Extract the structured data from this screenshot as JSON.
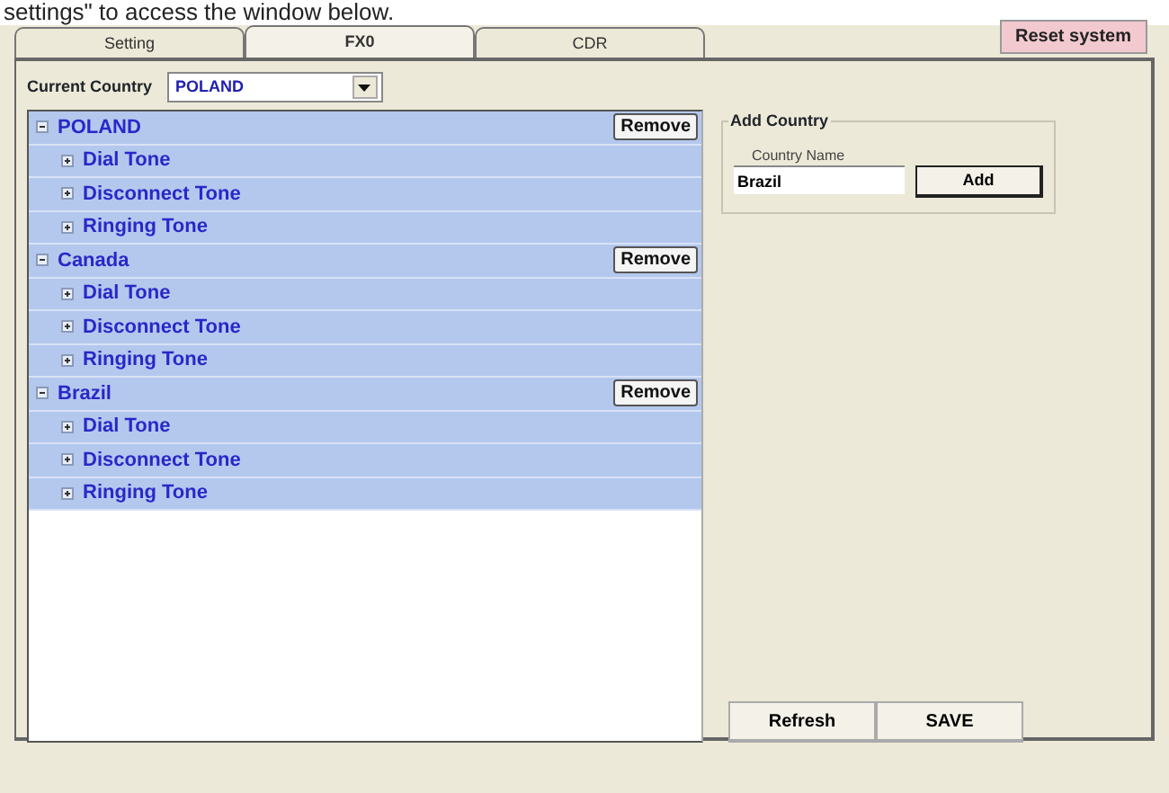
{
  "caption": "settings\" to access the window below.",
  "tabs": [
    {
      "label": "Setting",
      "selected": false
    },
    {
      "label": "FX0",
      "selected": true
    },
    {
      "label": "CDR",
      "selected": false
    }
  ],
  "reset_button": "Reset system",
  "current_country": {
    "label": "Current Country",
    "value": "POLAND"
  },
  "countries": [
    {
      "name": "POLAND",
      "expanded": true,
      "remove_button": "Remove",
      "tones": [
        {
          "name": "Dial Tone",
          "expanded": false
        },
        {
          "name": "Disconnect Tone",
          "expanded": false
        },
        {
          "name": "Ringing Tone",
          "expanded": false
        }
      ]
    },
    {
      "name": "Canada",
      "expanded": true,
      "remove_button": "Remove",
      "tones": [
        {
          "name": "Dial Tone",
          "expanded": false
        },
        {
          "name": "Disconnect Tone",
          "expanded": false
        },
        {
          "name": "Ringing Tone",
          "expanded": false
        }
      ]
    },
    {
      "name": "Brazil",
      "expanded": true,
      "remove_button": "Remove",
      "tones": [
        {
          "name": "Dial Tone",
          "expanded": false
        },
        {
          "name": "Disconnect Tone",
          "expanded": false
        },
        {
          "name": "Ringing Tone",
          "expanded": false
        }
      ]
    }
  ],
  "add_country": {
    "title": "Add Country",
    "field_label": "Country Name",
    "value": "Brazil",
    "button": "Add"
  },
  "buttons": [
    "Refresh",
    "SAVE"
  ]
}
